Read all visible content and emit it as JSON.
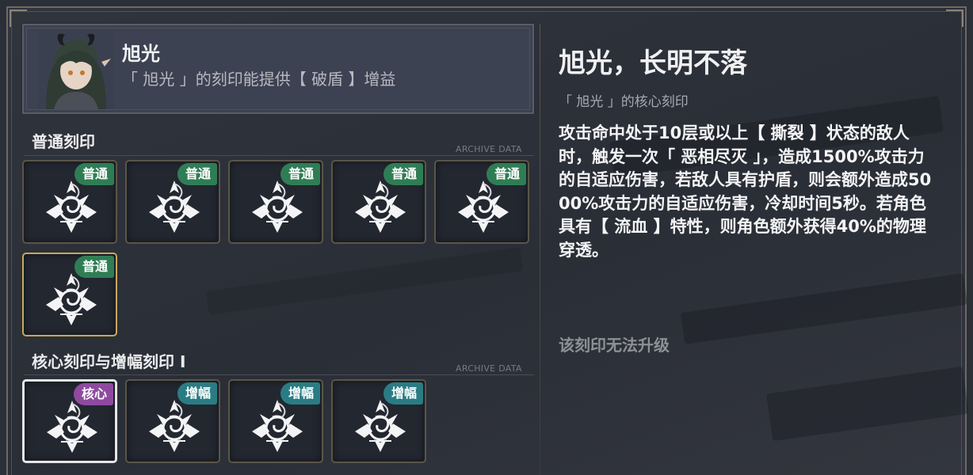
{
  "character": {
    "name": "旭光",
    "desc": "「 旭光 」的刻印能提供【 破盾 】增益",
    "portrait_icon": "character-portrait"
  },
  "sections": {
    "normal": {
      "title": "普通刻印",
      "archive": "ARCHIVE DATA"
    },
    "core": {
      "title": "核心刻印与增幅刻印 I",
      "archive": "ARCHIVE DATA"
    }
  },
  "normal_slots": [
    {
      "tag": "普通",
      "icon": "imprint-emblem-icon"
    },
    {
      "tag": "普通",
      "icon": "imprint-emblem-icon"
    },
    {
      "tag": "普通",
      "icon": "imprint-emblem-icon"
    },
    {
      "tag": "普通",
      "icon": "imprint-emblem-icon"
    },
    {
      "tag": "普通",
      "icon": "imprint-emblem-icon"
    },
    {
      "tag": "普通",
      "icon": "imprint-emblem-icon"
    }
  ],
  "core_slots": [
    {
      "tag": "核心",
      "icon": "imprint-emblem-icon"
    },
    {
      "tag": "增幅",
      "icon": "imprint-emblem-icon"
    },
    {
      "tag": "增幅",
      "icon": "imprint-emblem-icon"
    },
    {
      "tag": "增幅",
      "icon": "imprint-emblem-icon"
    }
  ],
  "detail": {
    "title": "旭光，长明不落",
    "subtitle": "「 旭光 」的核心刻印",
    "description": "攻击命中处于10层或以上【 撕裂 】状态的敌人时，触发一次「 恶相尽灭 」，造成1500%攻击力的自适应伤害，若敌人具有护盾，则会额外造成5000%攻击力的自适应伤害，冷却时间5秒。若角色具有【 流血 】特性，则角色额外获得40%的物理穿透。",
    "note": "该刻印无法升级"
  },
  "colors": {
    "normal_tag": "#2f7d55",
    "amp_tag": "#2a7c84",
    "core_tag": "#8e4aa0",
    "selected_border": "#c8a85e"
  }
}
